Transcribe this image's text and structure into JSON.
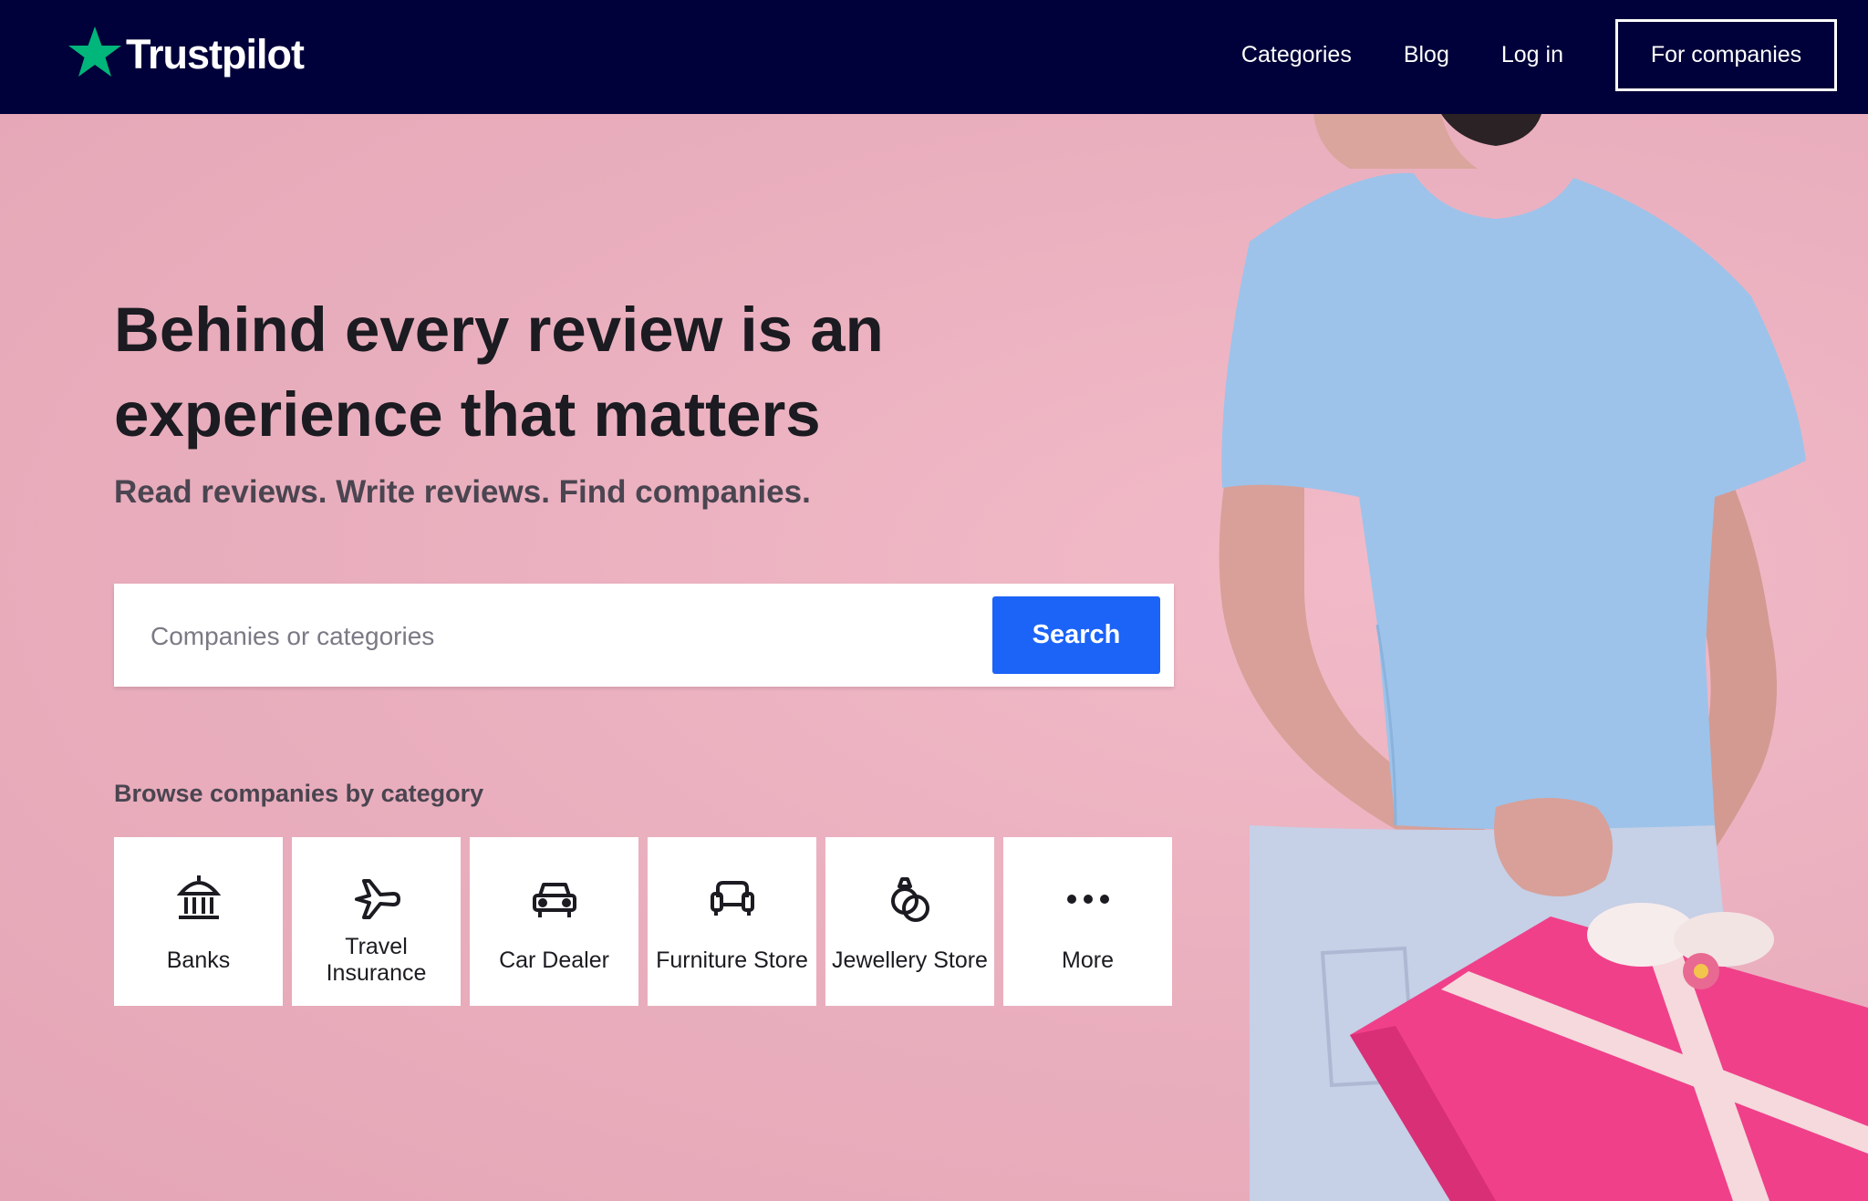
{
  "brand": {
    "name": "Trustpilot",
    "star_color": "#00b67a"
  },
  "nav": {
    "links": [
      {
        "label": "Categories"
      },
      {
        "label": "Blog"
      },
      {
        "label": "Log in"
      }
    ],
    "cta_label": "For companies",
    "background_color": "#00003a"
  },
  "hero": {
    "headline": "Behind every review is an experience that matters",
    "subheadline": "Read reviews. Write reviews. Find companies.",
    "background_color": "#e9aebd"
  },
  "search": {
    "placeholder": "Companies or categories",
    "button_label": "Search",
    "button_color": "#1c63f7"
  },
  "browse": {
    "title": "Browse companies by category",
    "categories": [
      {
        "label": "Banks",
        "icon": "bank-icon"
      },
      {
        "label": "Travel Insurance",
        "icon": "airplane-icon"
      },
      {
        "label": "Car Dealer",
        "icon": "car-icon"
      },
      {
        "label": "Furniture Store",
        "icon": "sofa-icon"
      },
      {
        "label": "Jewellery Store",
        "icon": "rings-icon"
      },
      {
        "label": "More",
        "icon": "more-dots-icon"
      }
    ]
  }
}
